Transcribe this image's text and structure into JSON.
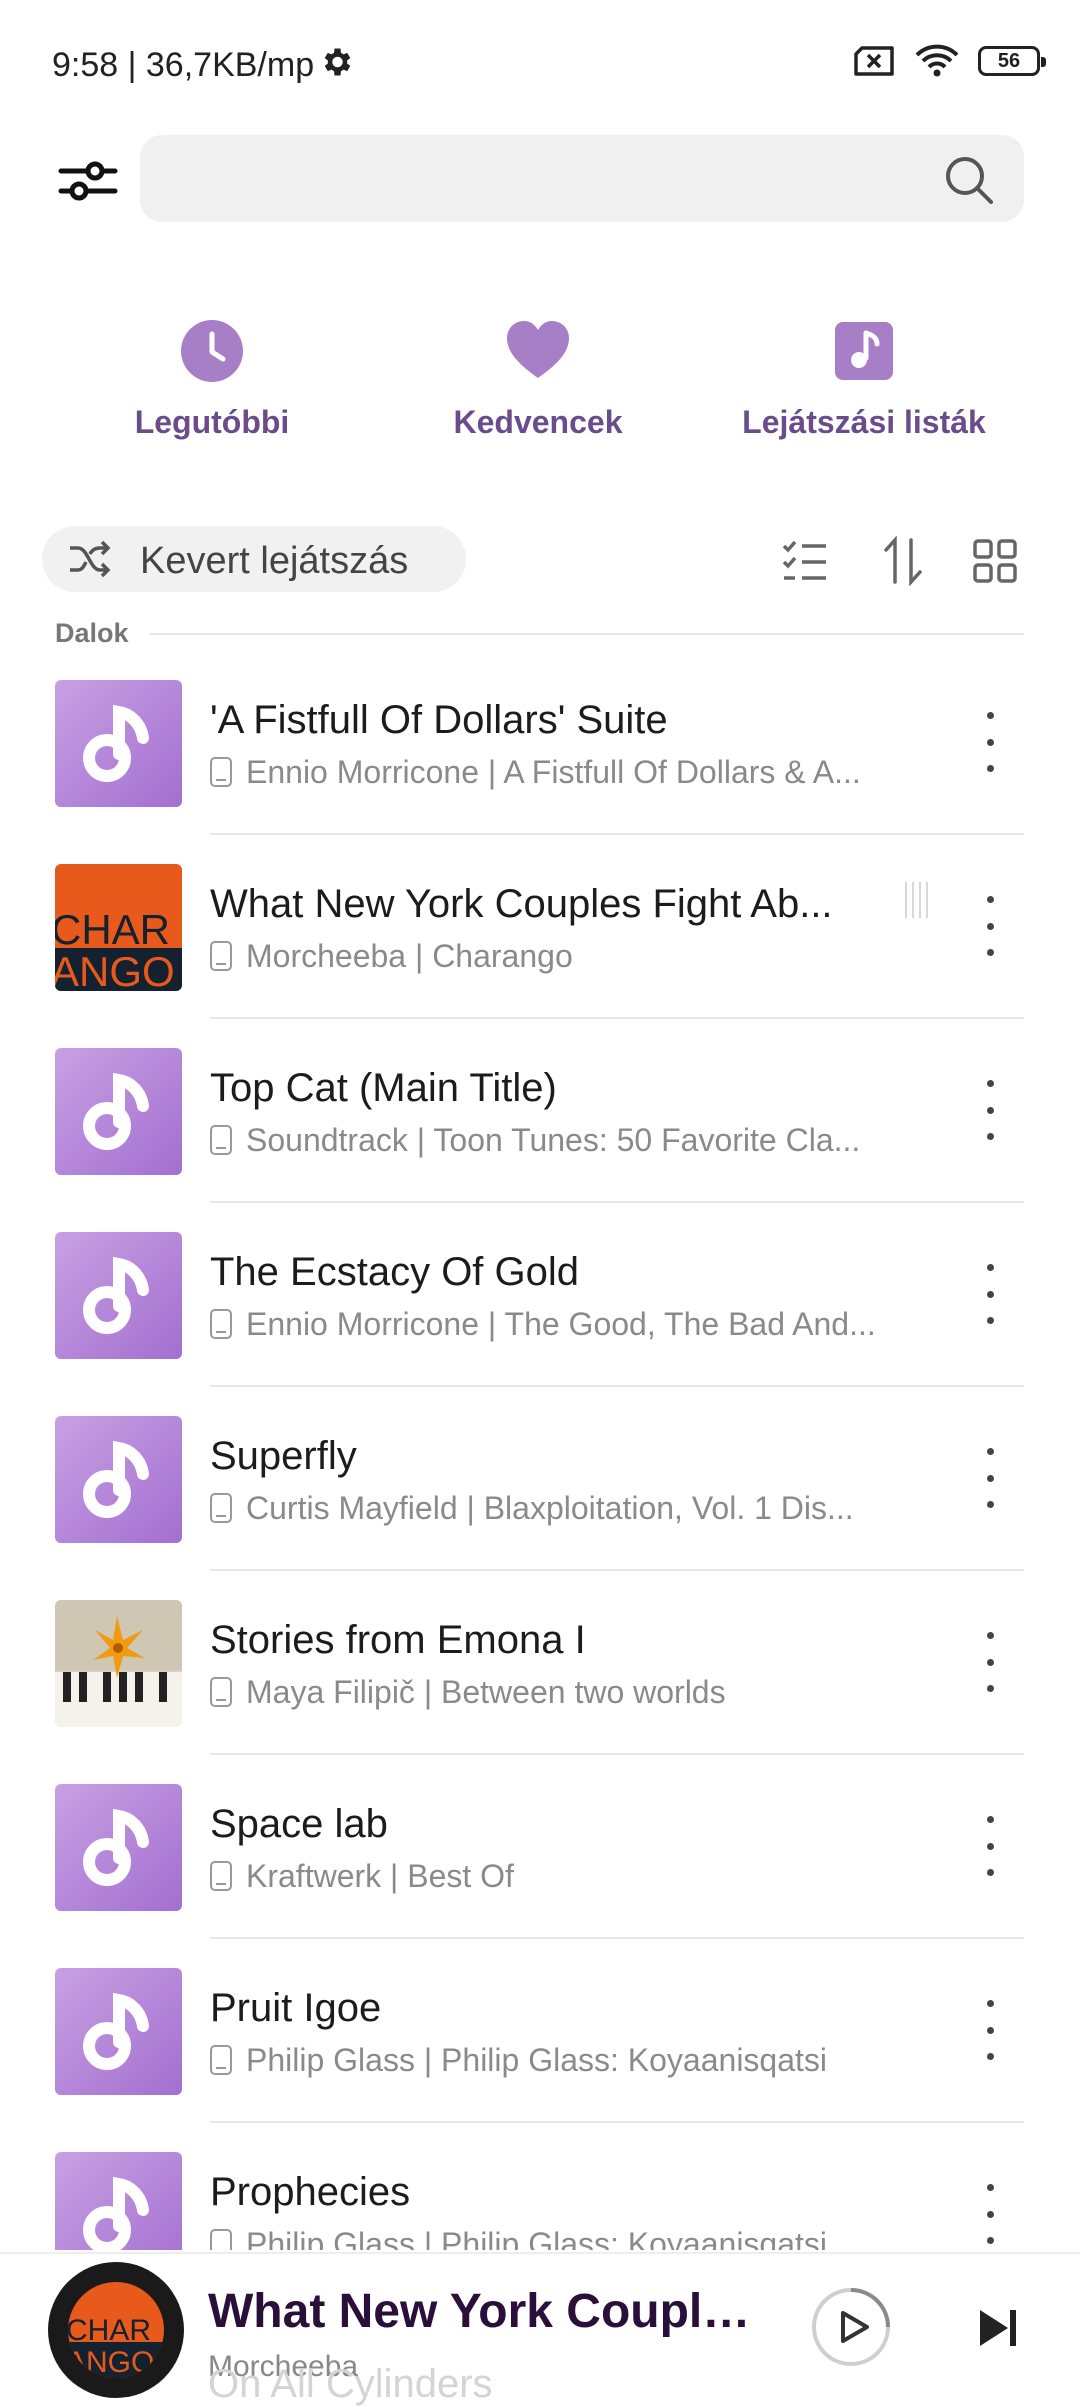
{
  "status_bar": {
    "time": "9:58 | 36,7KB/mp",
    "battery": "56"
  },
  "search": {
    "placeholder": ""
  },
  "quick_actions": [
    {
      "label": "Legutóbbi",
      "icon": "clock-icon"
    },
    {
      "label": "Kedvencek",
      "icon": "heart-icon"
    },
    {
      "label": "Lejátszási listák",
      "icon": "playlist-icon"
    }
  ],
  "toolbar": {
    "shuffle_label": "Kevert lejátszás"
  },
  "section": {
    "title": "Dalok"
  },
  "songs": [
    {
      "title": "'A Fistfull Of Dollars' Suite",
      "subtitle": "Ennio Morricone | A Fistfull Of Dollars & A..."
    },
    {
      "title": "What New York Couples Fight Ab...",
      "subtitle": "Morcheeba | Charango"
    },
    {
      "title": "Top Cat (Main Title)",
      "subtitle": "Soundtrack | Toon Tunes: 50 Favorite Cla..."
    },
    {
      "title": "The Ecstacy Of Gold",
      "subtitle": "Ennio Morricone | The Good, The Bad And..."
    },
    {
      "title": "Superfly",
      "subtitle": "Curtis Mayfield | Blaxploitation, Vol. 1 Dis..."
    },
    {
      "title": "Stories from Emona I",
      "subtitle": "Maya Filipič | Between two worlds"
    },
    {
      "title": "Space lab",
      "subtitle": "Kraftwerk | Best Of"
    },
    {
      "title": "Pruit Igoe",
      "subtitle": "Philip Glass | Philip Glass: Koyaanisqatsi"
    },
    {
      "title": "Prophecies",
      "subtitle": "Philip Glass | Philip Glass: Koyaanisqatsi"
    }
  ],
  "hidden_next_song": "On All Cylinders",
  "player": {
    "title": "What New York Couple...",
    "artist": "Morcheeba"
  },
  "colors": {
    "accent": "#a77fc7",
    "accent_text": "#6a4c8c"
  }
}
